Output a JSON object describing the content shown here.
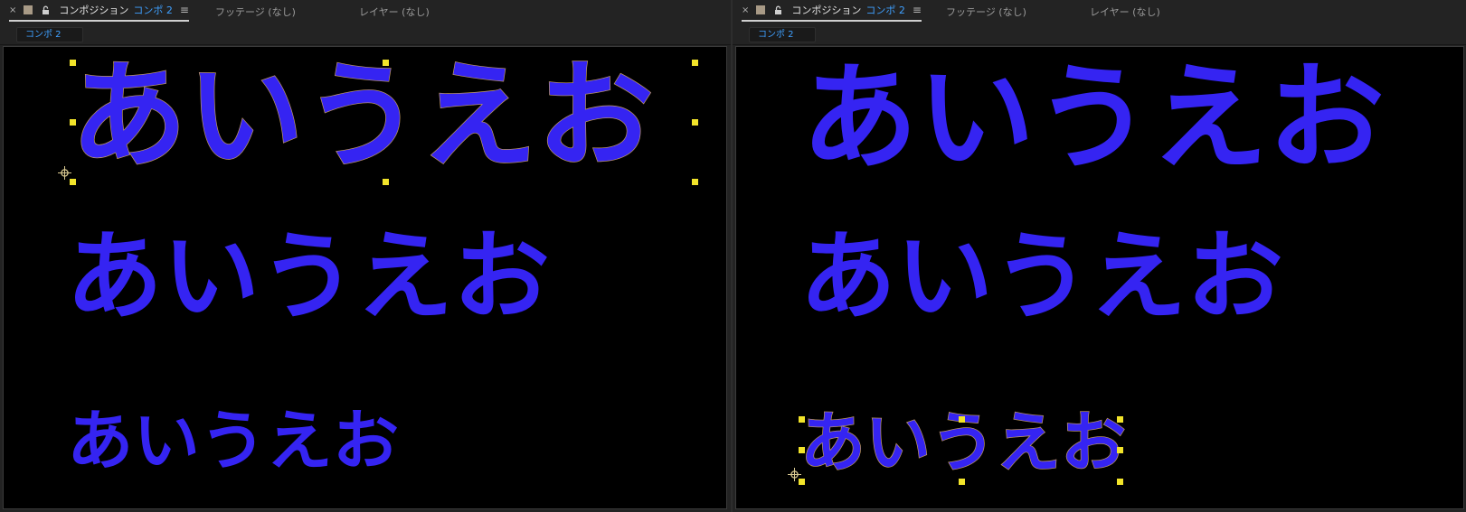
{
  "panels": [
    {
      "tab_close": "×",
      "tab_title": "コンポジション",
      "tab_comp": "コンポ 2",
      "tab_menu": "≡",
      "footage_tab": "フッテージ (なし)",
      "layer_tab": "レイヤー (なし)",
      "comp_chip": "コンポ 2",
      "texts": [
        "あいうえお",
        "あいうえお",
        "あいうえお"
      ],
      "selected_text_index": 0
    },
    {
      "tab_close": "×",
      "tab_title": "コンポジション",
      "tab_comp": "コンポ 2",
      "tab_menu": "≡",
      "footage_tab": "フッテージ (なし)",
      "layer_tab": "レイヤー (なし)",
      "comp_chip": "コンポ 2",
      "texts": [
        "あいうえお",
        "あいうえお",
        "あいうえお"
      ],
      "selected_text_index": 2
    }
  ],
  "colors": {
    "text_fill": "#3524f2",
    "selection_stroke": "#c8a060",
    "handle": "#f2e42a",
    "accent": "#3fa0ff",
    "viewer_bg": "#000000"
  },
  "icons": {
    "close": "close-icon",
    "swatch": "label-color-swatch-icon",
    "lock": "lock-icon",
    "menu": "panel-menu-icon",
    "anchor": "anchor-point-icon"
  }
}
